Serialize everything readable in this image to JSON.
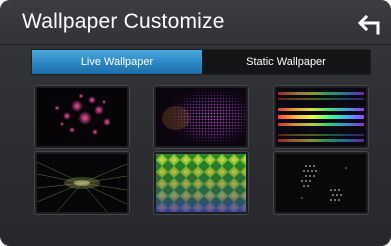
{
  "header": {
    "title": "Wallpaper Customize",
    "back_icon": "return-arrow-icon"
  },
  "tabs": [
    {
      "label": "Live Wallpaper",
      "selected": true
    },
    {
      "label": "Static Wallpaper",
      "selected": false
    }
  ],
  "colors": {
    "accent": "#2b86c2",
    "background": "#2f3135"
  },
  "wallpapers": [
    "pink-bokeh-wallpaper",
    "purple-dot-grid-wallpaper",
    "rainbow-bars-wallpaper",
    "light-rays-wallpaper",
    "green-diamonds-wallpaper",
    "white-dots-wallpaper"
  ]
}
